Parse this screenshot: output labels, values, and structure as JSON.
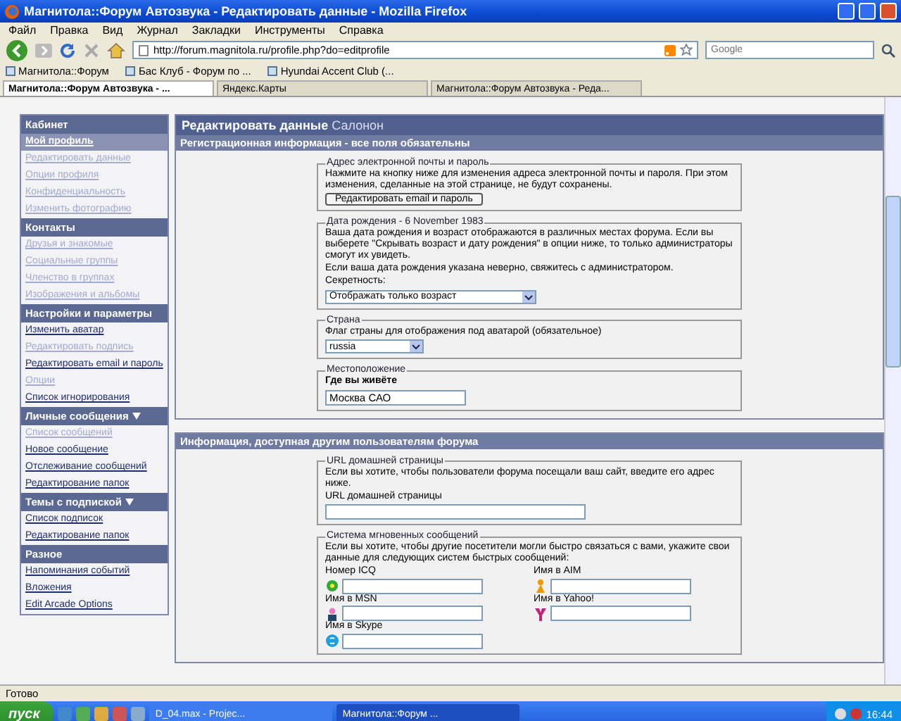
{
  "window": {
    "title": "Магнитола::Форум Автозвука - Редактировать данные - Mozilla Firefox"
  },
  "menu": [
    "Файл",
    "Правка",
    "Вид",
    "Журнал",
    "Закладки",
    "Инструменты",
    "Справка"
  ],
  "address": {
    "value": "http://forum.magnitola.ru/profile.php?do=editprofile"
  },
  "search": {
    "placeholder": "Google"
  },
  "bookmarks": [
    "Магнитола::Форум",
    "Бас Клуб - Форум по ...",
    "Hyundai Accent Club (..."
  ],
  "tabs": [
    {
      "label": "Магнитола::Форум Автозвука - ...",
      "selected": true
    },
    {
      "label": "Яндекс.Карты",
      "selected": false
    },
    {
      "label": "Магнитола::Форум Автозвука - Реда...",
      "selected": false
    }
  ],
  "sidebar": {
    "groups": [
      {
        "title": "Кабинет",
        "arrow": false,
        "items": [
          {
            "label": "Мой профиль",
            "selected": true,
            "disabled": false
          },
          {
            "label": "Редактировать данные",
            "selected": false,
            "disabled": true
          },
          {
            "label": "Опции профиля",
            "selected": false,
            "disabled": true
          },
          {
            "label": "Конфиденциальность",
            "selected": false,
            "disabled": true
          },
          {
            "label": "Изменить фотографию",
            "selected": false,
            "disabled": true
          }
        ]
      },
      {
        "title": "Контакты",
        "arrow": false,
        "items": [
          {
            "label": "Друзья и знакомые",
            "selected": false,
            "disabled": true
          },
          {
            "label": "Социальные группы",
            "selected": false,
            "disabled": true
          },
          {
            "label": "Членство в группах",
            "selected": false,
            "disabled": true
          },
          {
            "label": "Изображения и альбомы",
            "selected": false,
            "disabled": true
          }
        ]
      },
      {
        "title": "Настройки и параметры",
        "arrow": false,
        "items": [
          {
            "label": "Изменить аватар",
            "selected": false,
            "disabled": false
          },
          {
            "label": "Редактировать подпись",
            "selected": false,
            "disabled": true
          },
          {
            "label": "Редактировать email и пароль",
            "selected": false,
            "disabled": false
          },
          {
            "label": "Опции",
            "selected": false,
            "disabled": true
          },
          {
            "label": "Список игнорирования",
            "selected": false,
            "disabled": false
          }
        ]
      },
      {
        "title": "Личные сообщения",
        "arrow": true,
        "items": [
          {
            "label": "Список сообщений",
            "selected": false,
            "disabled": true
          },
          {
            "label": "Новое сообщение",
            "selected": false,
            "disabled": false
          },
          {
            "label": "Отслеживание сообщений",
            "selected": false,
            "disabled": false
          },
          {
            "label": "Редактирование папок",
            "selected": false,
            "disabled": false
          }
        ]
      },
      {
        "title": "Темы с подпиской",
        "arrow": true,
        "items": [
          {
            "label": "Список подписок",
            "selected": false,
            "disabled": false
          },
          {
            "label": "Редактирование папок",
            "selected": false,
            "disabled": false
          }
        ]
      },
      {
        "title": "Разное",
        "arrow": false,
        "items": [
          {
            "label": "Напоминания событий",
            "selected": false,
            "disabled": false
          },
          {
            "label": "Вложения",
            "selected": false,
            "disabled": false
          },
          {
            "label": "Edit Arcade Options",
            "selected": false,
            "disabled": false
          }
        ]
      }
    ]
  },
  "page": {
    "title": "Редактировать данные",
    "user": "Салонон"
  },
  "sections": [
    {
      "title": "Регистрационная информация - все поля обязательны",
      "fieldsets": [
        {
          "legend": "Адрес электронной почты и пароль",
          "paragraphs": [
            "Нажмите на кнопку ниже для изменения адреса электронной почты и пароля. При этом изменения, сделанные на этой странице, не будут сохранены."
          ],
          "kind": "button",
          "button": "Редактировать email и пароль"
        },
        {
          "legend": "Дата рождения - 6 November 1983",
          "paragraphs": [
            "Ваша дата рождения и возраст отображаются в различных местах форума. Если вы выберете \"Скрывать возраст и дату рождения\" в опции ниже, то только администраторы смогут их увидеть.",
            "Если ваша дата рождения указана неверно, свяжитесь с администратором."
          ],
          "label": "Секретность:",
          "kind": "select",
          "select": "Отображать только возраст"
        },
        {
          "legend": "Страна",
          "label": "Флаг страны для отображения под аватарой (обязательное)",
          "kind": "select",
          "select": "russia"
        },
        {
          "legend": "Местоположение",
          "label": "Где вы живёте",
          "bold_label": true,
          "kind": "input",
          "input": "Москва САО"
        }
      ]
    },
    {
      "title": "Информация, доступная другим пользователям форума",
      "fieldsets": [
        {
          "legend": "URL домашней страницы",
          "paragraphs": [
            "Если вы хотите, чтобы пользователи форума посещали ваш сайт, введите его адрес ниже."
          ],
          "label": "URL домашней страницы",
          "kind": "input"
        },
        {
          "legend": "Система мгновенных сообщений",
          "paragraphs": [
            "Если вы хотите, чтобы другие посетители могли быстро связаться с вами, укажите свои данные для следующих систем быстрых сообщений:"
          ],
          "kind": "messengers",
          "messengers": [
            {
              "kind": "icq",
              "label": "Номер ICQ"
            },
            {
              "kind": "aim",
              "label": "Имя в AIM"
            },
            {
              "kind": "msn",
              "label": "Имя в MSN"
            },
            {
              "kind": "yahoo",
              "label": "Имя в Yahoo!"
            },
            {
              "kind": "skype",
              "label": "Имя в Skype"
            }
          ]
        }
      ]
    }
  ],
  "status_bar": "Готово",
  "taskbar": {
    "start": "пуск",
    "tasks": [
      {
        "label": "D_04.max - Projec...",
        "selected": false
      },
      {
        "label": "Магнитола::Форум ...",
        "selected": true
      }
    ],
    "clock": "16:44"
  }
}
